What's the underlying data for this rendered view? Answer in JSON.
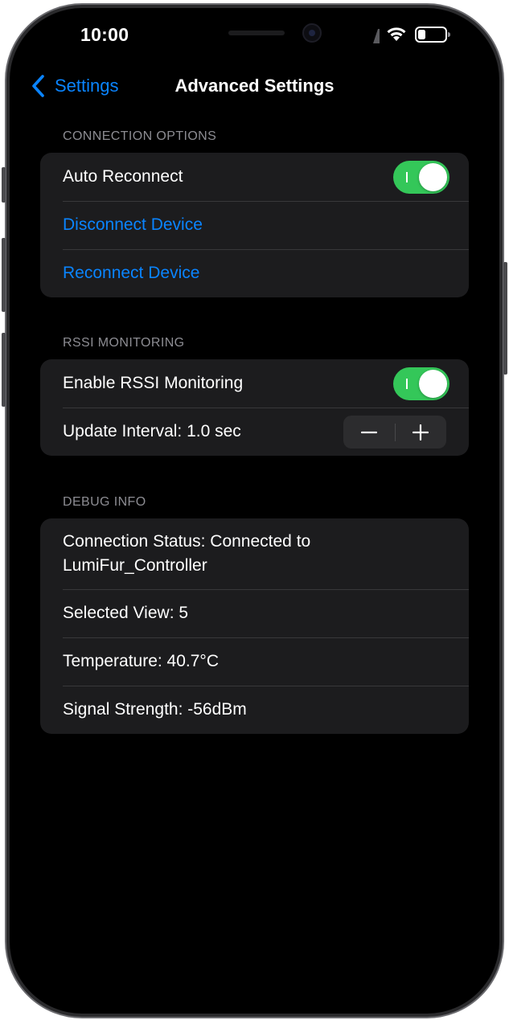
{
  "status_bar": {
    "time": "10:00",
    "icons": [
      "cellular-signal-icon",
      "wifi-icon",
      "battery-icon"
    ]
  },
  "nav": {
    "back_label": "Settings",
    "back_icon": "chevron-left-icon",
    "title": "Advanced Settings"
  },
  "connection_options": {
    "header": "CONNECTION OPTIONS",
    "auto_reconnect": {
      "label": "Auto Reconnect",
      "on": true
    },
    "disconnect_label": "Disconnect Device",
    "reconnect_label": "Reconnect Device"
  },
  "rssi_monitoring": {
    "header": "RSSI MONITORING",
    "enable": {
      "label": "Enable RSSI Monitoring",
      "on": true
    },
    "update_interval_label": "Update Interval: 1.0 sec",
    "stepper": {
      "minus_icon": "minus-icon",
      "plus_icon": "plus-icon"
    }
  },
  "debug_info": {
    "header": "DEBUG INFO",
    "items": [
      "Connection Status: Connected to LumiFur_Controller",
      "Selected View: 5",
      "Temperature: 40.7°C",
      "Signal Strength: -56dBm"
    ]
  },
  "colors": {
    "accent": "#0a84ff",
    "toggle_on": "#34c759",
    "group_bg": "#1c1c1e",
    "screen_bg": "#000000",
    "secondary_text": "#8d8d93"
  }
}
